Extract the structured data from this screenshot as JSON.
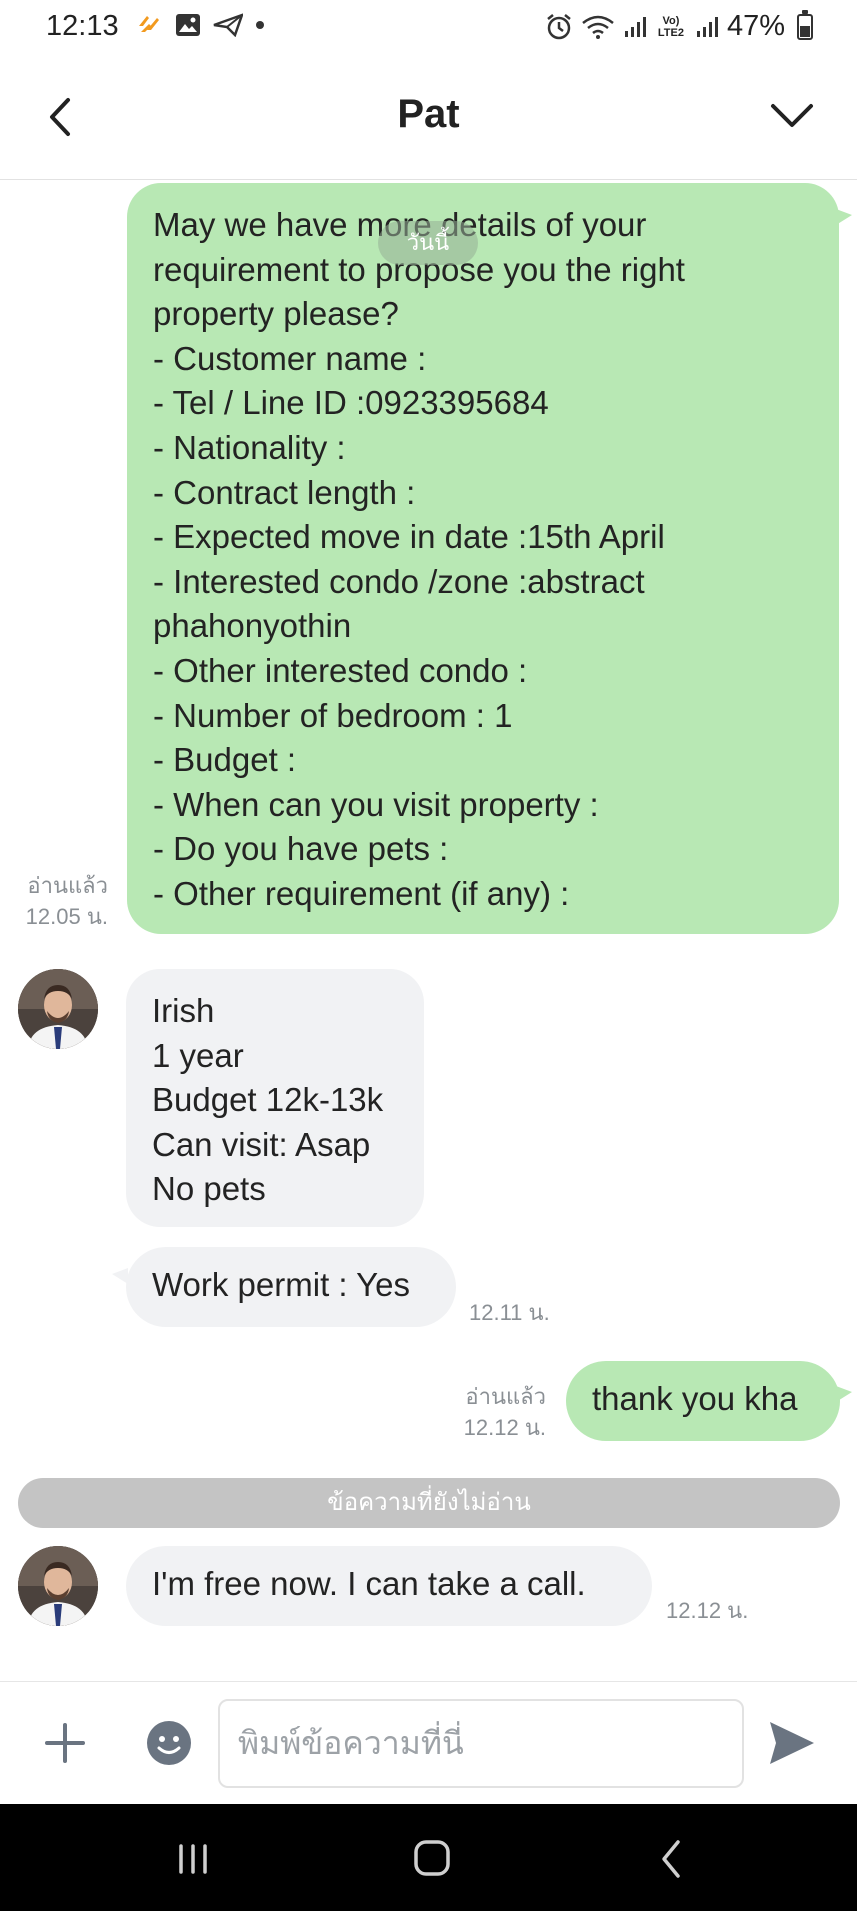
{
  "status_bar": {
    "time": "12:13",
    "lte_label": "Vo) LTE2",
    "battery": "47%",
    "battery_level": 0.47
  },
  "header": {
    "title": "Pat"
  },
  "chat": {
    "date_divider": "วันนี้",
    "messages": [
      {
        "lines": [
          "May we have more details of your",
          "requirement to propose you the right",
          "property please?",
          "- Customer name :",
          "- Tel / Line ID :0923395684",
          "- Nationality :",
          "- Contract length :",
          "- Expected move in date :15th April",
          "- Interested condo /zone :abstract",
          "phahonyothin",
          "- Other interested condo :",
          "- Number of bedroom  : 1",
          "- Budget :",
          "- When can you visit property :",
          "- Do you have pets :",
          "- Other requirement (if any) :"
        ],
        "read": "อ่านแล้ว",
        "time": "12.05 น."
      },
      {
        "lines": [
          "Irish",
          "1 year",
          "Budget 12k-13k",
          "Can visit: Asap",
          "No pets"
        ]
      },
      {
        "lines": [
          "Work permit : Yes"
        ],
        "time": "12.11 น."
      },
      {
        "lines": [
          "thank you kha"
        ],
        "read": "อ่านแล้ว",
        "time": "12.12 น."
      },
      {
        "lines": [
          "I'm free now. I can take a call."
        ],
        "time": "12.12 น."
      }
    ],
    "unread_divider": "ข้อความที่ยังไม่อ่าน"
  },
  "input_bar": {
    "placeholder": "พิมพ์ข้อความที่นี่"
  },
  "colors": {
    "outgoing_bubble": "#b8e8b4",
    "incoming_bubble": "#f1f2f4",
    "unread_bar": "#c4c4c4",
    "icon_gray": "#6a7481"
  }
}
